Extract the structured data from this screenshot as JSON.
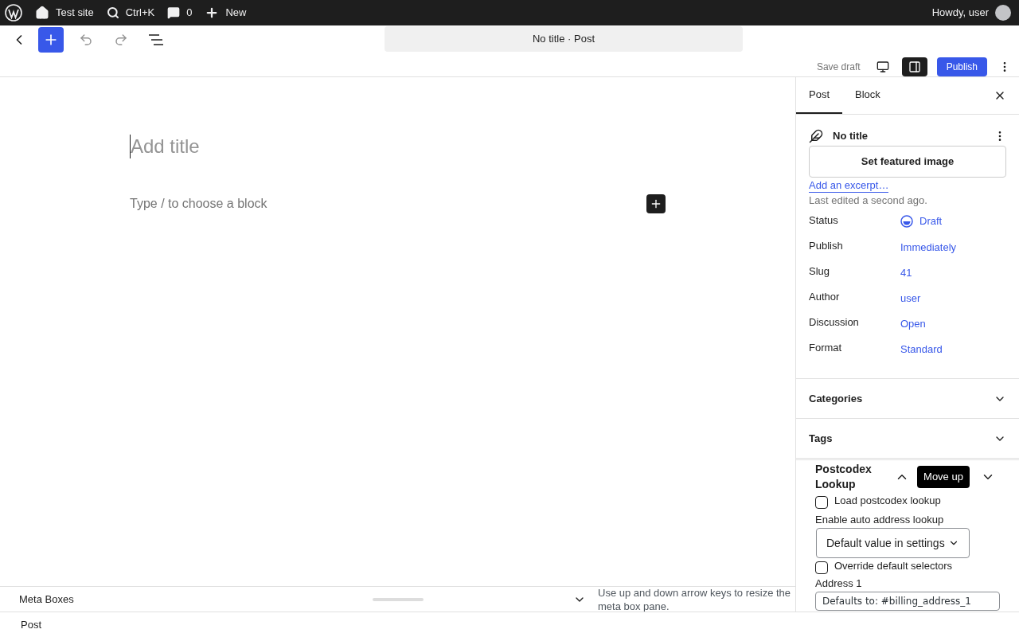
{
  "admin_bar": {
    "site": "Test site",
    "search": "Ctrl+K",
    "comments": "0",
    "new": "New",
    "greeting": "Howdy, user"
  },
  "header": {
    "document_title": "No title · Post",
    "save_draft": "Save draft",
    "publish": "Publish",
    "settings_open": true
  },
  "editor": {
    "title_placeholder": "Add title",
    "block_placeholder": "Type / to choose a block"
  },
  "sidebar": {
    "tabs": [
      {
        "label": "Post",
        "selected": true
      },
      {
        "label": "Block",
        "selected": false
      }
    ],
    "post_title": "No title",
    "featured_image": "Set featured image",
    "excerpt": "Add an excerpt…",
    "last_edited": "Last edited a second ago.",
    "fields": [
      {
        "label": "Status",
        "value": "Draft",
        "kind": "status"
      },
      {
        "label": "Publish",
        "value": "Immediately",
        "kind": "link"
      },
      {
        "label": "Slug",
        "value": "41",
        "kind": "link"
      },
      {
        "label": "Author",
        "value": "user",
        "kind": "link"
      },
      {
        "label": "Discussion",
        "value": "Open",
        "kind": "link"
      },
      {
        "label": "Format",
        "value": "Standard",
        "kind": "link"
      }
    ],
    "panels": [
      {
        "title": "Categories",
        "expanded": false
      },
      {
        "title": "Tags",
        "expanded": false
      }
    ],
    "metabox": {
      "title": "Postcodex Lookup",
      "tooltip": "Move up",
      "load_lookup": {
        "label": "Load postcodex lookup",
        "checked": false
      },
      "auto_label": "Enable auto address lookup",
      "auto_value": "Default value in settings",
      "override": {
        "label": "Override default selectors",
        "checked": false
      },
      "address_label": "Address 1",
      "address_placeholder": "Defaults to: #billing_address_1"
    }
  },
  "meta_boxes_bar": {
    "title": "Meta Boxes",
    "hint": "Use up and down arrow keys to resize the meta box pane."
  },
  "footer": {
    "breadcrumb": "Post"
  }
}
